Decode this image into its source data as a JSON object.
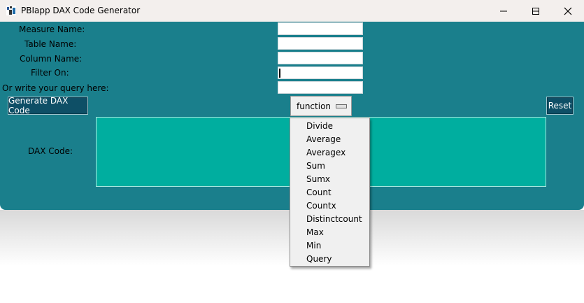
{
  "window": {
    "title": "PBIapp DAX Code Generator"
  },
  "form": {
    "labels": {
      "measure_name": "Measure Name:",
      "table_name": "Table Name:",
      "column_name": "Column Name:",
      "filter_on": "Filter On:",
      "query": "Or write your query here:",
      "dax_code": "DAX Code:"
    },
    "values": {
      "measure_name": "",
      "table_name": "",
      "column_name": "",
      "filter_on": "",
      "query": ""
    }
  },
  "buttons": {
    "generate": "Generate DAX Code",
    "reset": "Reset"
  },
  "function_menu": {
    "selected": "function",
    "options": [
      "Divide",
      "Average",
      "Averagex",
      "Sum",
      "Sumx",
      "Count",
      "Countx",
      "Distinctcount",
      "Max",
      "Min",
      "Query"
    ]
  },
  "colors": {
    "background": "#1a7f8c",
    "text_area": "#00ae9f",
    "button": "#0e4f66",
    "title_bar": "#f3efed"
  }
}
